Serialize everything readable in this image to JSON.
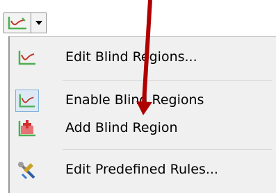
{
  "toolbar": {
    "button_icon": "blind-region-chart-icon",
    "dropdown_icon": "dropdown-triangle-icon"
  },
  "menu": {
    "items": [
      {
        "label": "Edit Blind Regions...",
        "icon": "blind-region-chart-icon"
      },
      {
        "label": "Enable Blind Regions",
        "icon": "blind-region-chart-icon",
        "checked": true
      },
      {
        "label": "Add Blind Region",
        "icon": "add-blind-region-icon"
      },
      {
        "label": "Edit Predefined Rules...",
        "icon": "rules-wrench-icon"
      }
    ]
  },
  "colors": {
    "chart_icon": "#4caf50",
    "chart_curve": "#c0392b",
    "annotation_arrow": "#b00000"
  }
}
